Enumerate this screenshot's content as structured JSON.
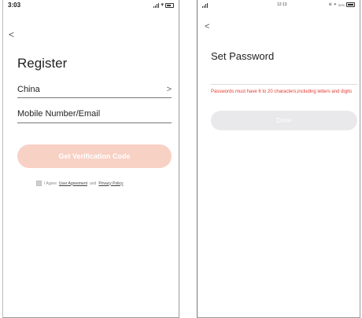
{
  "register_screen": {
    "status": {
      "time": "3:03"
    },
    "title": "Register",
    "country": {
      "value": "China",
      "chevron": ">"
    },
    "account_field": {
      "placeholder": "Mobile Number/Email"
    },
    "verify_button": {
      "label": "Get Verification Code",
      "color": "#f8d1c5"
    },
    "agreement": {
      "prefix": "I Agree",
      "user_agreement": "User Agreement",
      "and": "and",
      "privacy_policy": "Privacy Policy"
    },
    "back_glyph": "<"
  },
  "password_screen": {
    "status": {
      "time": "12:13",
      "battery": "52%"
    },
    "title": "Set Password",
    "hint": "Passwords must have 6 to 20 characters,including letters and digits",
    "hint_color": "#e23a2f",
    "done_button": {
      "label": "Done",
      "color": "#e9e9ec"
    },
    "back_glyph": "<"
  },
  "icons": [
    "signal-icon",
    "wifi-icon",
    "battery-icon",
    "back-arrow-icon",
    "chevron-right-icon",
    "checkbox-icon"
  ]
}
